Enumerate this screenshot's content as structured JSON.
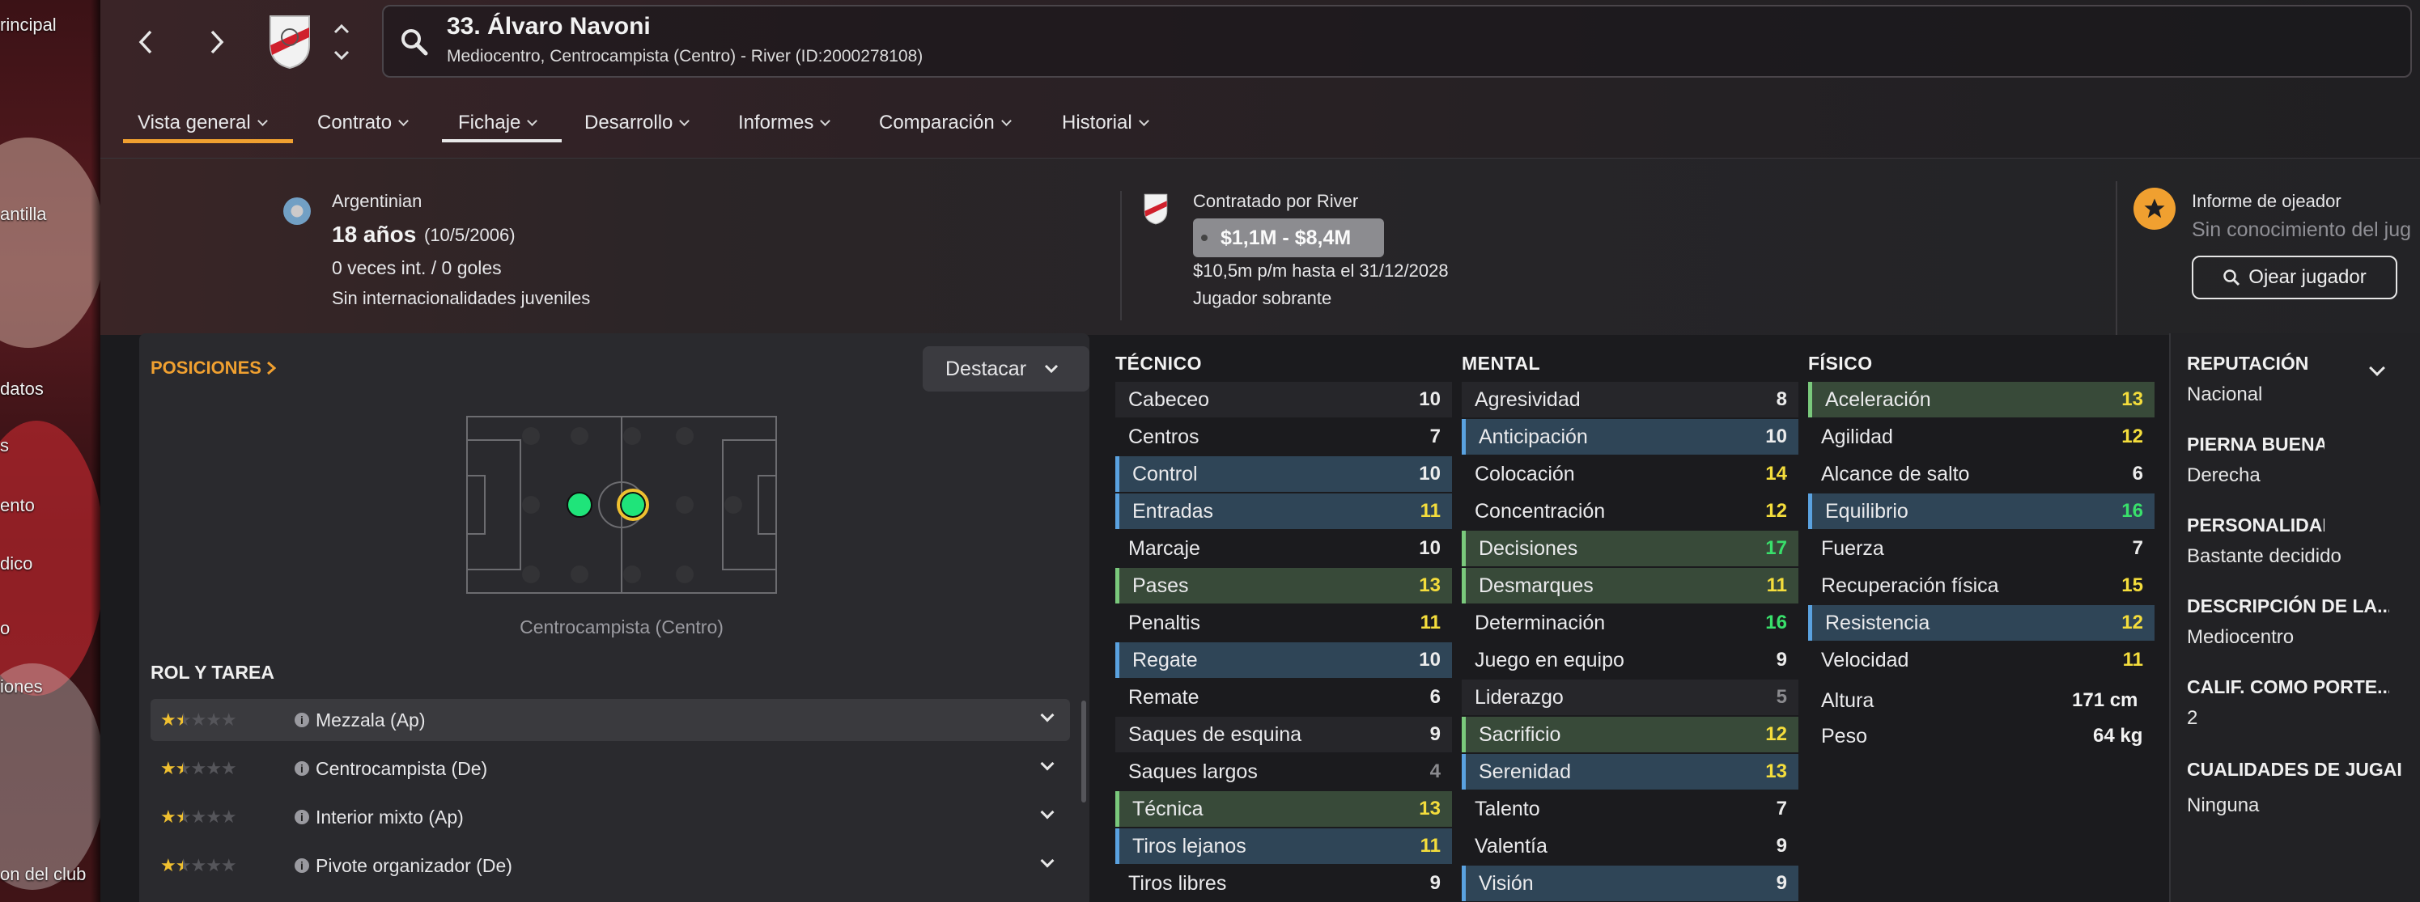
{
  "sidebar": {
    "items": [
      "rincipal",
      "antilla",
      "datos",
      "s",
      "ento",
      "dico",
      "o",
      "iones",
      "on del club"
    ]
  },
  "header": {
    "player_title": "33. Álvaro Navoni",
    "player_subtitle": "Mediocentro, Centrocampista (Centro) - River (ID:2000278108)"
  },
  "tabs": [
    {
      "label": "Vista general",
      "active": true
    },
    {
      "label": "Contrato",
      "active": false
    },
    {
      "label": "Fichaje",
      "active": false
    },
    {
      "label": "Desarrollo",
      "active": false
    },
    {
      "label": "Informes",
      "active": false
    },
    {
      "label": "Comparación",
      "active": false
    },
    {
      "label": "Historial",
      "active": false
    }
  ],
  "bio": {
    "nationality": "Argentinian",
    "age": "18 años",
    "dob": "(10/5/2006)",
    "caps": "0 veces int. / 0 goles",
    "youth_caps": "Sin internacionalidades juveniles"
  },
  "contract": {
    "hired_by": "Contratado por River",
    "value": "$1,1M - $8,4M",
    "wage": "$10,5m p/m hasta el 31/12/2028",
    "status": "Jugador sobrante"
  },
  "scout": {
    "title": "Informe de ojeador",
    "knowledge": "Sin conocimiento del jug",
    "button": "Ojear jugador"
  },
  "positions": {
    "title": "POSICIONES",
    "highlight_button": "Destacar",
    "position_label": "Centrocampista (Centro)"
  },
  "roles": {
    "title": "ROL Y TAREA",
    "items": [
      {
        "label": "Mezzala (Ap)",
        "stars": 1.5
      },
      {
        "label": "Centrocampista (De)",
        "stars": 1.5
      },
      {
        "label": "Interior mixto (Ap)",
        "stars": 1.5
      },
      {
        "label": "Pivote organizador (De)",
        "stars": 1.5
      }
    ]
  },
  "tecnico": {
    "title": "TÉCNICO",
    "rows": [
      {
        "n": "Cabeceo",
        "v": "10",
        "c": "white",
        "h": "alt"
      },
      {
        "n": "Centros",
        "v": "7",
        "c": "white",
        "h": "plain"
      },
      {
        "n": "Control",
        "v": "10",
        "c": "white",
        "h": "blue"
      },
      {
        "n": "Entradas",
        "v": "11",
        "c": "yellow",
        "h": "blue"
      },
      {
        "n": "Marcaje",
        "v": "10",
        "c": "white",
        "h": "plain"
      },
      {
        "n": "Pases",
        "v": "13",
        "c": "yellow",
        "h": "green"
      },
      {
        "n": "Penaltis",
        "v": "11",
        "c": "yellow",
        "h": "plain"
      },
      {
        "n": "Regate",
        "v": "10",
        "c": "white",
        "h": "blue"
      },
      {
        "n": "Remate",
        "v": "6",
        "c": "white",
        "h": "plain"
      },
      {
        "n": "Saques de esquina",
        "v": "9",
        "c": "white",
        "h": "alt"
      },
      {
        "n": "Saques largos",
        "v": "4",
        "c": "grey",
        "h": "plain"
      },
      {
        "n": "Técnica",
        "v": "13",
        "c": "yellow",
        "h": "green"
      },
      {
        "n": "Tiros lejanos",
        "v": "11",
        "c": "yellow",
        "h": "blue"
      },
      {
        "n": "Tiros libres",
        "v": "9",
        "c": "white",
        "h": "plain"
      }
    ]
  },
  "mental": {
    "title": "MENTAL",
    "rows": [
      {
        "n": "Agresividad",
        "v": "8",
        "c": "white",
        "h": "alt"
      },
      {
        "n": "Anticipación",
        "v": "10",
        "c": "white",
        "h": "blue"
      },
      {
        "n": "Colocación",
        "v": "14",
        "c": "yellow",
        "h": "plain"
      },
      {
        "n": "Concentración",
        "v": "12",
        "c": "yellow",
        "h": "plain"
      },
      {
        "n": "Decisiones",
        "v": "17",
        "c": "green",
        "h": "green"
      },
      {
        "n": "Desmarques",
        "v": "11",
        "c": "yellow",
        "h": "green"
      },
      {
        "n": "Determinación",
        "v": "16",
        "c": "green",
        "h": "plain"
      },
      {
        "n": "Juego en equipo",
        "v": "9",
        "c": "white",
        "h": "plain"
      },
      {
        "n": "Liderazgo",
        "v": "5",
        "c": "grey",
        "h": "alt"
      },
      {
        "n": "Sacrificio",
        "v": "12",
        "c": "yellow",
        "h": "green"
      },
      {
        "n": "Serenidad",
        "v": "13",
        "c": "yellow",
        "h": "blue"
      },
      {
        "n": "Talento",
        "v": "7",
        "c": "white",
        "h": "plain"
      },
      {
        "n": "Valentía",
        "v": "9",
        "c": "white",
        "h": "plain"
      },
      {
        "n": "Visión",
        "v": "9",
        "c": "white",
        "h": "blue"
      }
    ]
  },
  "fisico": {
    "title": "FÍSICO",
    "rows": [
      {
        "n": "Aceleración",
        "v": "13",
        "c": "yellow",
        "h": "green"
      },
      {
        "n": "Agilidad",
        "v": "12",
        "c": "yellow",
        "h": "plain"
      },
      {
        "n": "Alcance de salto",
        "v": "6",
        "c": "white",
        "h": "plain"
      },
      {
        "n": "Equilibrio",
        "v": "16",
        "c": "green",
        "h": "blue"
      },
      {
        "n": "Fuerza",
        "v": "7",
        "c": "white",
        "h": "plain"
      },
      {
        "n": "Recuperación física",
        "v": "15",
        "c": "yellow",
        "h": "plain"
      },
      {
        "n": "Resistencia",
        "v": "12",
        "c": "yellow",
        "h": "blue"
      },
      {
        "n": "Velocidad",
        "v": "11",
        "c": "yellow",
        "h": "plain"
      }
    ],
    "height_label": "Altura",
    "height": "171 cm",
    "weight_label": "Peso",
    "weight": "64 kg"
  },
  "profile": [
    {
      "h": "REPUTACIÓN",
      "v": "Nacional"
    },
    {
      "h": "PIERNA BUENA",
      "v": "Derecha"
    },
    {
      "h": "PERSONALIDAD",
      "v": "Bastante decidido"
    },
    {
      "h": "DESCRIPCIÓN DE LA...",
      "v": "Mediocentro"
    },
    {
      "h": "CALIF. COMO PORTE...",
      "v": "2"
    },
    {
      "h": "CUALIDADES DE JUGAI",
      "v": "Ninguna"
    }
  ],
  "colors": {
    "accent_orange": "#f0a030",
    "highlight_blue": "#2f4557",
    "highlight_green": "#384a39",
    "attr_yellow": "#f4dd3c",
    "attr_green": "#39e06b"
  }
}
